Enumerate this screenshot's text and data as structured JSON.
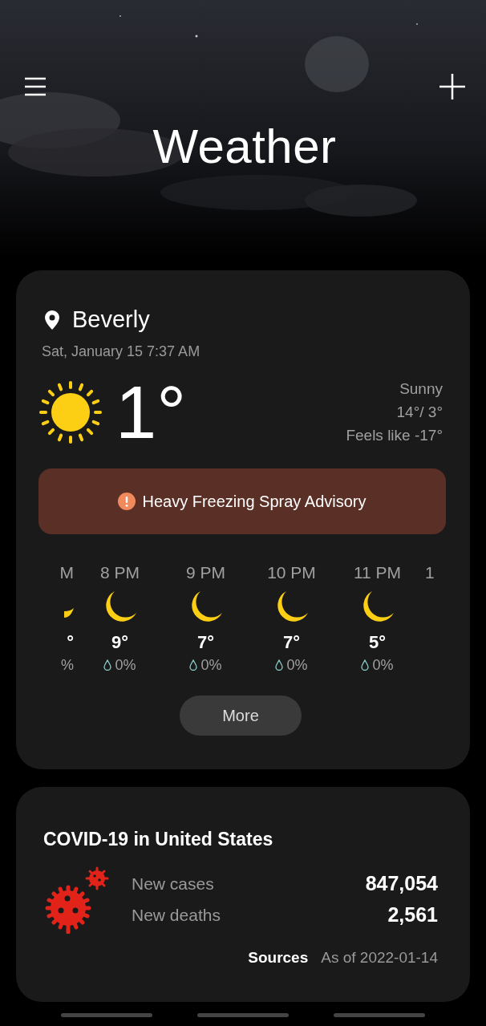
{
  "header": {
    "title": "Weather"
  },
  "location": {
    "name": "Beverly",
    "datetime": "Sat, January 15 7:37 AM"
  },
  "current": {
    "temperature": "1°",
    "condition": "Sunny",
    "high_low": "14°/ 3°",
    "feels_like": "Feels like -17°"
  },
  "alert": {
    "text": "Heavy Freezing Spray Advisory"
  },
  "hourly": [
    {
      "kind": "cut-start",
      "time": "M",
      "temperature": "°",
      "precipitation": "%"
    },
    {
      "kind": "full",
      "time": "8 PM",
      "temperature": "9°",
      "precipitation": "0%"
    },
    {
      "kind": "full",
      "time": "9 PM",
      "temperature": "7°",
      "precipitation": "0%"
    },
    {
      "kind": "full",
      "time": "10 PM",
      "temperature": "7°",
      "precipitation": "0%"
    },
    {
      "kind": "full",
      "time": "11 PM",
      "temperature": "5°",
      "precipitation": "0%"
    },
    {
      "kind": "cut-end",
      "time": "1"
    }
  ],
  "more_button": "More",
  "covid": {
    "title": "COVID-19 in United States",
    "stats": [
      {
        "label": "New cases",
        "value": "847,054"
      },
      {
        "label": "New deaths",
        "value": "2,561"
      }
    ],
    "sources": "Sources",
    "as_of": "As of 2022-01-14"
  }
}
